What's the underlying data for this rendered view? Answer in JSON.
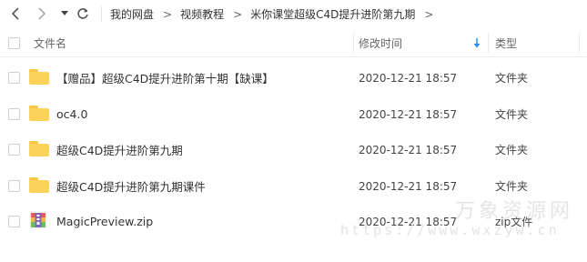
{
  "breadcrumb": [
    "我的网盘",
    "视频教程",
    "米你课堂超级C4D提升进阶第九期"
  ],
  "columns": {
    "name": "文件名",
    "modified": "修改时间",
    "type": "类型",
    "sort_icon": "sort-descending-icon"
  },
  "files": [
    {
      "name": "【赠品】超级C4D提升进阶第十期【缺课】",
      "modified": "2020-12-21 18:57",
      "type": "文件夹",
      "icon": "folder-icon"
    },
    {
      "name": "oc4.0",
      "modified": "2020-12-21 18:57",
      "type": "文件夹",
      "icon": "folder-icon"
    },
    {
      "name": "超级C4D提升进阶第九期",
      "modified": "2020-12-21 18:57",
      "type": "文件夹",
      "icon": "folder-icon"
    },
    {
      "name": "超级C4D提升进阶第九期课件",
      "modified": "2020-12-21 18:57",
      "type": "文件夹",
      "icon": "folder-icon"
    },
    {
      "name": "MagicPreview.zip",
      "modified": "2020-12-21 18:57",
      "type": "zip文件",
      "icon": "zip-file-icon"
    }
  ],
  "watermark": {
    "title": "万象资源网",
    "url": "https://www.wxzyw.cn"
  },
  "colors": {
    "folder": "#fbd35b",
    "accent": "#2b8ef0"
  }
}
